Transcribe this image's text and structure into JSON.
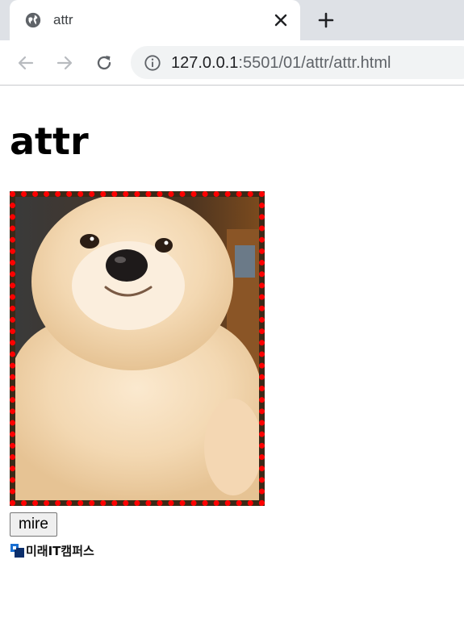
{
  "browser": {
    "tab_title": "attr",
    "url_host": "127.0.0.1",
    "url_rest": ":5501/01/attr/attr.html"
  },
  "page": {
    "heading": "attr",
    "image_alt": "white fluffy puppy",
    "button_label": "mire",
    "logo_text": "미래IT캠퍼스",
    "colors": {
      "frame_border": "#ff0000"
    }
  },
  "icons": [
    "globe-icon",
    "close-icon",
    "plus-icon",
    "back-arrow-icon",
    "forward-arrow-icon",
    "reload-icon",
    "info-icon"
  ]
}
